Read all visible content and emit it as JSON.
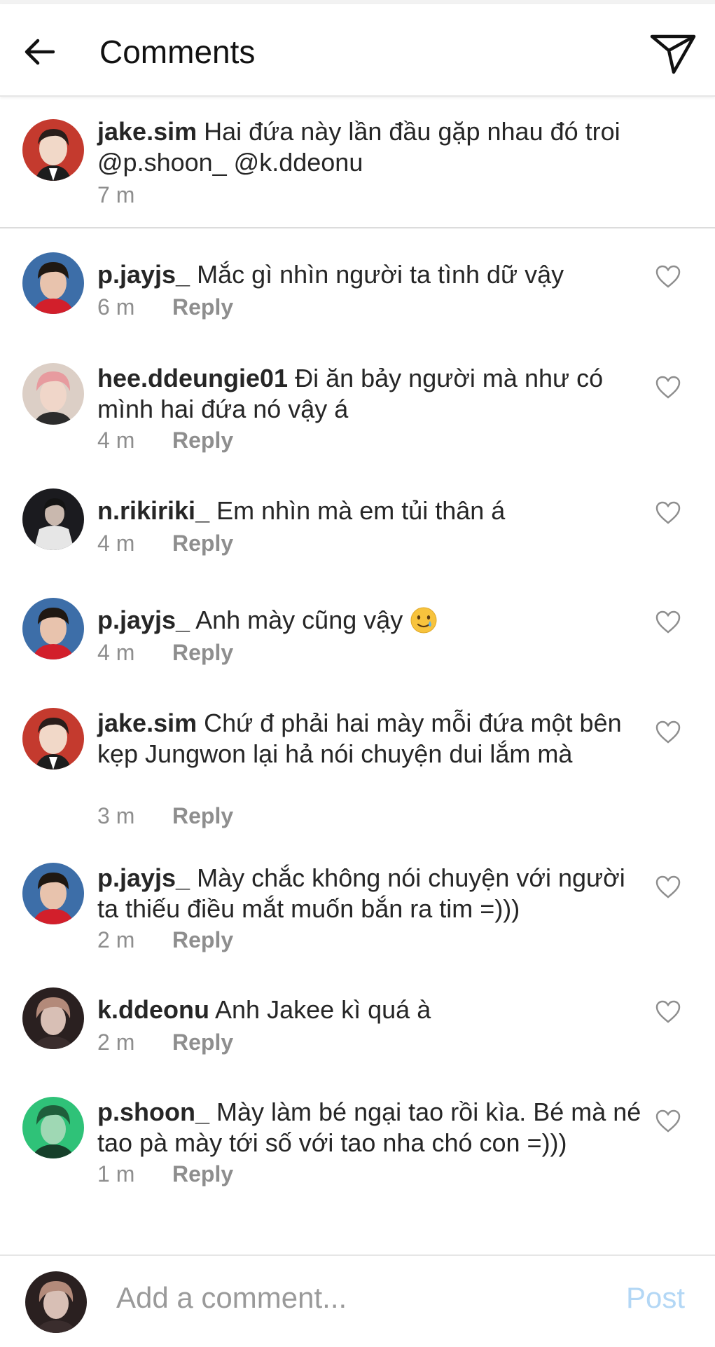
{
  "header": {
    "title": "Comments",
    "back_icon": "arrow-left-icon",
    "send_icon": "paper-plane-icon"
  },
  "caption": {
    "username": "jake.sim",
    "text": "Hai đứa này lần đầu gặp nhau đó troi @p.shoon_ @k.ddeonu",
    "time": "7 m"
  },
  "comments": [
    {
      "username": "p.jayjs_",
      "text": "Mắc gì nhìn người ta tình dữ vậy",
      "time": "6 m",
      "reply": "Reply"
    },
    {
      "username": "hee.ddeungie01",
      "text": "Đi ăn bảy người mà như có mình hai đứa nó vậy á",
      "time": "4 m",
      "reply": "Reply"
    },
    {
      "username": "n.rikiriki_",
      "text": "Em nhìn mà em tủi thân á",
      "time": "4 m",
      "reply": "Reply"
    },
    {
      "username": "p.jayjs_",
      "text": "Anh mày cũng vậy",
      "emoji": "smiling-face-with-tear",
      "time": "4 m",
      "reply": "Reply"
    },
    {
      "username": "jake.sim",
      "text": "Chứ đ phải hai mày mỗi đứa một bên kẹp Jungwon lại hả nói chuyện dui lắm mà",
      "time": "3 m",
      "reply": "Reply"
    },
    {
      "username": "p.jayjs_",
      "text": "Mày chắc không nói chuyện với người ta thiếu điều mắt muốn bắn ra tim =)))",
      "time": "2 m",
      "reply": "Reply"
    },
    {
      "username": "k.ddeonu",
      "text": "Anh Jakee kì quá à",
      "time": "2 m",
      "reply": "Reply"
    },
    {
      "username": "p.shoon_",
      "text": "Mày làm bé ngại tao rồi kìa. Bé mà né tao pà mày tới số với tao nha chó con =)))",
      "time": "1 m",
      "reply": "Reply"
    }
  ],
  "composer": {
    "placeholder": "Add a comment...",
    "post_label": "Post"
  },
  "colors": {
    "meta_gray": "#8e8e8e",
    "post_disabled": "#b3d7f5"
  }
}
